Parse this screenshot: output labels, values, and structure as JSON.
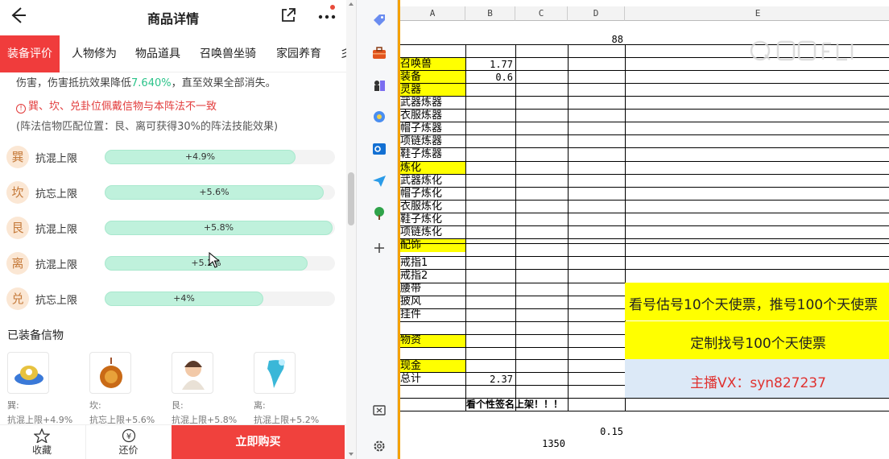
{
  "phone": {
    "title": "商品详情",
    "tabs": [
      "装备评价",
      "人物修为",
      "物品道具",
      "召唤兽坐骑",
      "家园养育",
      "彡"
    ],
    "desc_a": "伤害，伤害抵抗效果降低",
    "desc_pct": "7.640%",
    "desc_b": "，直至效果全部消失。",
    "warn_icon": "!",
    "warning": "巽、坎、兑卦位佩戴信物与本阵法不一致",
    "note": "(阵法信物匹配位置：艮、离可获得30%的阵法技能效果)",
    "rows": [
      {
        "badge": "巽",
        "label": "抗混上限",
        "value": "+4.9%",
        "fill": 0.83
      },
      {
        "badge": "坎",
        "label": "抗忘上限",
        "value": "+5.6%",
        "fill": 0.95
      },
      {
        "badge": "艮",
        "label": "抗混上限",
        "value": "+5.8%",
        "fill": 0.99
      },
      {
        "badge": "离",
        "label": "抗混上限",
        "value": "+5.2%",
        "fill": 0.88
      },
      {
        "badge": "兑",
        "label": "抗忘上限",
        "value": "+4%",
        "fill": 0.69
      }
    ],
    "equipped_title": "已装备信物",
    "items": [
      {
        "pos": "巽:",
        "effect": "抗混上限+4.9%"
      },
      {
        "pos": "坎:",
        "effect": "抗忘上限+5.6%"
      },
      {
        "pos": "艮:",
        "effect": "抗混上限+5.8%"
      },
      {
        "pos": "离:",
        "effect": "抗混上限+5.2%"
      }
    ],
    "bottom": {
      "favorite": "收藏",
      "bargain": "还价",
      "bargain_icon": "¥",
      "buy": "立即购买"
    }
  },
  "sheet": {
    "columns": [
      "A",
      "B",
      "C",
      "D",
      "E"
    ],
    "d_top": "88",
    "labels": [
      "召唤兽",
      "装备",
      "灵器",
      "武器炼器",
      "衣服炼器",
      "帽子炼器",
      "项链炼器",
      "鞋子炼器",
      "炼化",
      "武器炼化",
      "帽子炼化",
      "衣服炼化",
      "鞋子炼化",
      "项链炼化",
      "配饰",
      "戒指1",
      "戒指2",
      "腰带",
      "披风",
      "挂件",
      "",
      "物资",
      "",
      "现金",
      "总计"
    ],
    "values": {
      "summon": "1.77",
      "equip": "0.6",
      "total": "2.37"
    },
    "banner": "看号估号10个天使票，推号100个天使票",
    "custom": "定制找号100个天使票",
    "contact": "主播VX：syn827237",
    "footer_text": "看个性签名上架！！！",
    "d_bottom": "0.15",
    "c_bottom": "1350"
  },
  "colors": {
    "accent": "#f03c3c",
    "yellow": "#ffff00",
    "green": "#2cc38a"
  }
}
